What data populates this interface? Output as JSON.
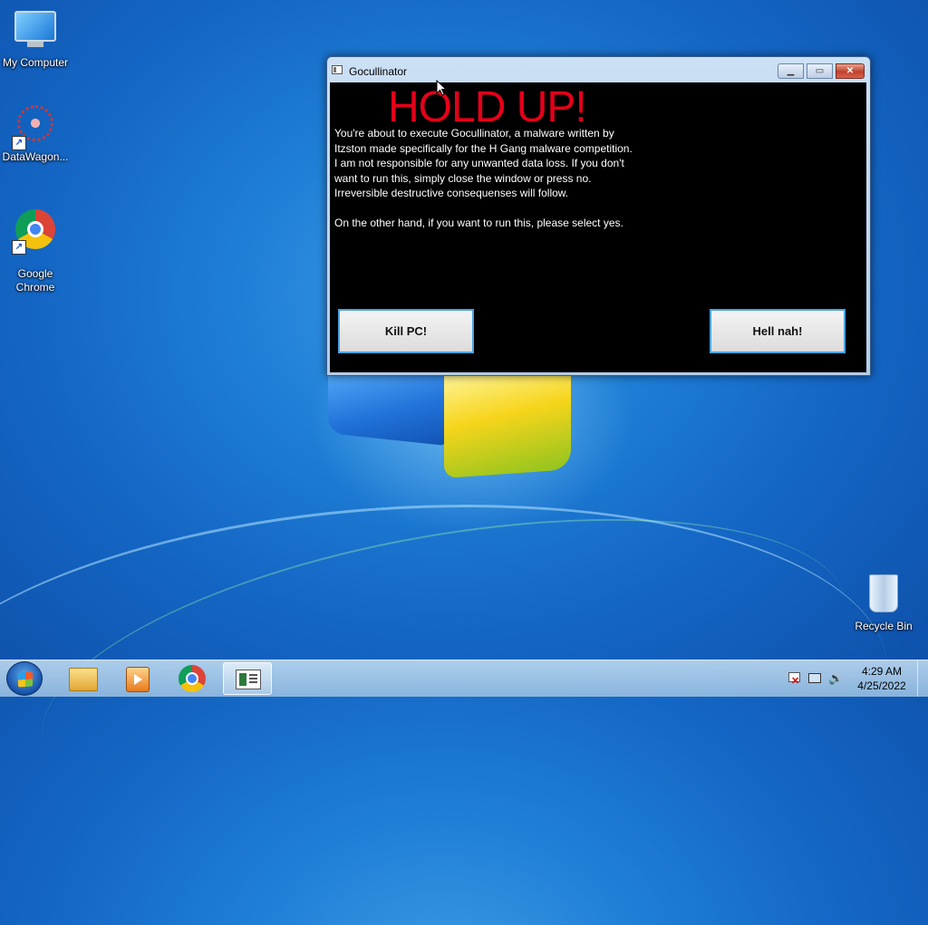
{
  "desktop": {
    "icons": [
      {
        "label": "My Computer",
        "icon": "computer-icon"
      },
      {
        "label": "DataWagon...",
        "icon": "datawagon-icon"
      },
      {
        "label": "Google\nChrome",
        "icon": "chrome-icon"
      },
      {
        "label": "Recycle Bin",
        "icon": "recycle-bin-icon"
      }
    ]
  },
  "window": {
    "title": "Gocullinator",
    "controls": {
      "minimize": "▁",
      "maximize": "▭",
      "close": "✕"
    },
    "heading": "HOLD UP!",
    "message": "You're about to execute Gocullinator, a malware written by\nItzston made specifically for the H Gang malware competition.\nI am not responsible for any unwanted data loss. If you don't\nwant to run this, simply close the window or press no.\nIrreversible destructive consequenses will follow.\n\nOn the other hand, if you want to run this, please select yes.",
    "buttons": {
      "yes": "Kill PC!",
      "no": "Hell nah!"
    },
    "colors": {
      "heading": "#e4001a",
      "background": "#000000",
      "text": "#ffffff"
    }
  },
  "taskbar": {
    "start": "start-button",
    "pinned": [
      {
        "name": "explorer",
        "icon": "folder-icon"
      },
      {
        "name": "media-player",
        "icon": "media-player-icon"
      },
      {
        "name": "chrome",
        "icon": "chrome-icon"
      },
      {
        "name": "gocullinator",
        "icon": "app-window-icon"
      }
    ],
    "tray": {
      "time": "4:29 AM",
      "date": "4/25/2022"
    }
  }
}
